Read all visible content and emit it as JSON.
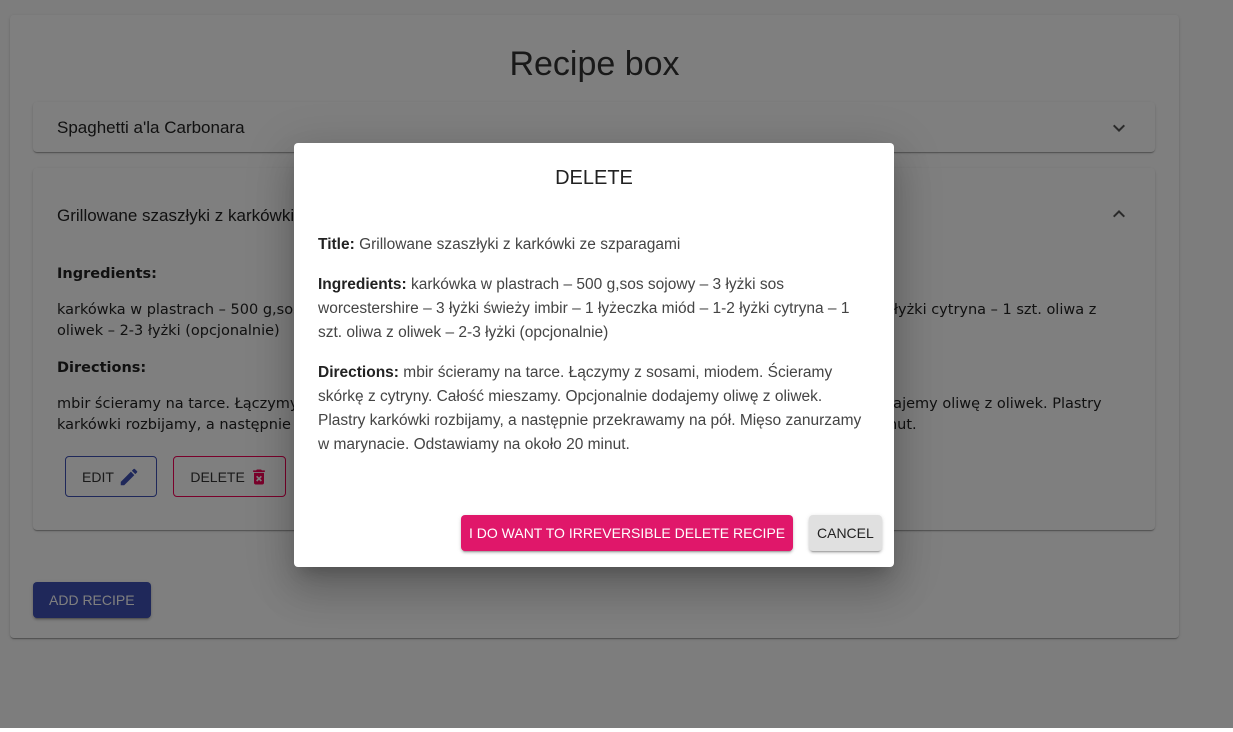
{
  "app": {
    "title": "Recipe box",
    "add_recipe_label": "ADD RECIPE",
    "colors": {
      "primary": "#3f51b5",
      "secondary": "#e0176a",
      "backdrop": "rgba(0,0,0,0.5)"
    }
  },
  "recipes": [
    {
      "title": "Spaghetti a'la Carbonara",
      "expanded": false,
      "icon": "chevron-down-icon"
    },
    {
      "title": "Grillowane szaszłyki z karkówki ze szparagami",
      "expanded": true,
      "icon": "chevron-up-icon",
      "ingredients_heading": "Ingredients:",
      "ingredients": "karkówka w plastrach – 500 g,sos sojowy – 3 łyżki sos worcestershire – 3 łyżki świeży imbir – 1 łyżeczka miód – 1-2 łyżki cytryna – 1 szt. oliwa z oliwek – 2-3 łyżki (opcjonalnie)",
      "directions_heading": "Directions:",
      "directions": "mbir ścieramy na tarce. Łączymy z sosami, miodem. Ścieramy skórkę z cytryny. Całość mieszamy. Opcjonalnie dodajemy oliwę z oliwek. Plastry karkówki rozbijamy, a następnie przekrawamy na pół. Mięso zanurzamy w marynacie. Odstawiamy na około 20 minut.",
      "edit_label": "EDIT",
      "delete_label": "DELETE"
    }
  ],
  "dialog": {
    "title": "DELETE",
    "title_label": "Title:",
    "title_value": "Grillowane szaszłyki z karkówki ze szparagami",
    "ingredients_label": "Ingredients:",
    "ingredients_value": "karkówka w plastrach – 500 g,sos sojowy – 3 łyżki sos worcestershire – 3 łyżki świeży imbir – 1 łyżeczka miód – 1-2 łyżki cytryna – 1 szt. oliwa z oliwek – 2-3 łyżki (opcjonalnie)",
    "directions_label": "Directions:",
    "directions_value": "mbir ścieramy na tarce. Łączymy z sosami, miodem. Ścieramy skórkę z cytryny. Całość mieszamy. Opcjonalnie dodajemy oliwę z oliwek. Plastry karkówki rozbijamy, a następnie przekrawamy na pół. Mięso zanurzamy w marynacie. Odstawiamy na około 20 minut.",
    "confirm_label": "I DO WANT TO IRREVERSIBLE DELETE RECIPE",
    "cancel_label": "CANCEL"
  }
}
